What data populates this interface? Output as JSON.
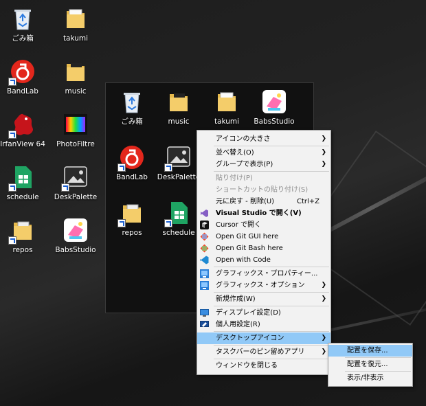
{
  "desktop_icons": [
    {
      "label": "ごみ箱",
      "icon": "recycle-bin-icon"
    },
    {
      "label": "takumi",
      "icon": "folder-icon"
    },
    {
      "label": "BandLab",
      "icon": "bandlab-icon"
    },
    {
      "label": "music",
      "icon": "folder-icon"
    },
    {
      "label": "IrfanView 64",
      "icon": "irfanview-icon"
    },
    {
      "label": "PhotoFiltre",
      "icon": "photofiltre-icon"
    },
    {
      "label": "schedule",
      "icon": "sheets-icon"
    },
    {
      "label": "DeskPalette",
      "icon": "deskpalette-icon"
    },
    {
      "label": "repos",
      "icon": "folder-icon"
    },
    {
      "label": "BabsStudio",
      "icon": "babsstudio-icon"
    }
  ],
  "panel_icons": [
    {
      "label": "ごみ箱",
      "icon": "recycle-bin-icon"
    },
    {
      "label": "music",
      "icon": "folder-icon"
    },
    {
      "label": "takumi",
      "icon": "folder-icon"
    },
    {
      "label": "BabsStudio",
      "icon": "babsstudio-icon"
    },
    {
      "label": "BandLab",
      "icon": "bandlab-icon"
    },
    {
      "label": "DeskPalette",
      "icon": "deskpalette-icon"
    },
    {
      "label": "repos",
      "icon": "folder-icon"
    },
    {
      "label": "schedule",
      "icon": "sheets-icon"
    }
  ],
  "context_menu": {
    "items": [
      {
        "label": "アイコンの大きさ",
        "submenu": true
      },
      {
        "label": "並べ替え(O)",
        "submenu": true
      },
      {
        "label": "グループで表示(P)",
        "submenu": true
      },
      {
        "label": "貼り付け(P)",
        "disabled": true
      },
      {
        "label": "ショートカットの貼り付け(S)",
        "disabled": true
      },
      {
        "label": "元に戻す - 削除(U)",
        "shortcut": "Ctrl+Z"
      },
      {
        "label": "Visual Studio で開く(V)",
        "icon": "visual-studio-icon"
      },
      {
        "label": "Cursor で開く",
        "icon": "cursor-icon"
      },
      {
        "label": "Open Git GUI here",
        "icon": "git-gui-icon"
      },
      {
        "label": "Open Git Bash here",
        "icon": "git-bash-icon"
      },
      {
        "label": "Open with Code",
        "icon": "vscode-icon"
      },
      {
        "label": "グラフィックス・プロパティー...",
        "icon": "intel-graphics-icon"
      },
      {
        "label": "グラフィックス・オプション",
        "icon": "intel-graphics-icon",
        "submenu": true
      },
      {
        "label": "新規作成(W)",
        "submenu": true
      },
      {
        "label": "ディスプレイ設定(D)",
        "icon": "display-icon"
      },
      {
        "label": "個人用設定(R)",
        "icon": "personalize-icon"
      },
      {
        "label": "デスクトップアイコン",
        "submenu": true,
        "highlighted": true
      },
      {
        "label": "タスクバーのピン留めアプリ",
        "submenu": true
      },
      {
        "label": "ウィンドウを閉じる"
      }
    ]
  },
  "submenu": {
    "items": [
      {
        "label": "配置を保存...",
        "highlighted": true
      },
      {
        "label": "配置を復元..."
      },
      {
        "label": "表示/非表示"
      }
    ]
  }
}
